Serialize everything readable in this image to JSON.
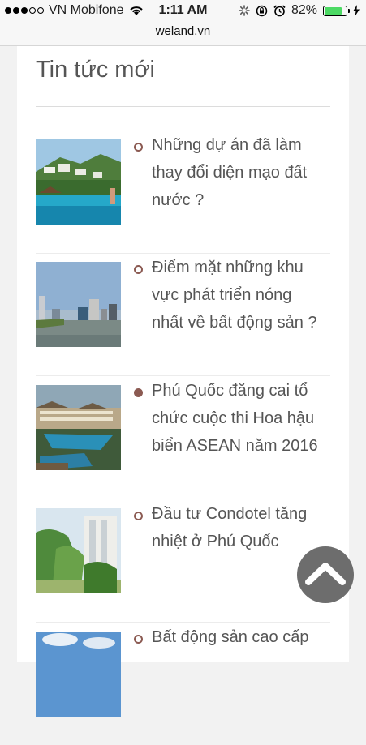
{
  "status": {
    "carrier": "VN Mobifone",
    "time": "1:11 AM",
    "battery_percent": "82%",
    "battery_level": 0.82,
    "signal_dots_full": 3,
    "signal_dots_total": 5
  },
  "browser": {
    "url": "weland.vn"
  },
  "section": {
    "title": "Tin tức mới"
  },
  "news": [
    {
      "title": "Những dự án đã làm thay đổi diện mạo đất nước ?",
      "bullet": "hollow",
      "image": "resort-pool"
    },
    {
      "title": "Điểm mặt những khu vực phát triển nóng nhất về bất động sản ?",
      "bullet": "hollow",
      "image": "city-skyline"
    },
    {
      "title": "Phú Quốc đăng cai tổ chức cuộc thi Hoa hậu biển ASEAN năm 2016",
      "bullet": "filled",
      "image": "hotel-pool"
    },
    {
      "title": "Đầu tư Condotel tăng nhiệt ở Phú Quốc",
      "bullet": "hollow",
      "image": "condotel"
    },
    {
      "title": "Bất động sản cao cấp",
      "bullet": "hollow",
      "image": "sky"
    }
  ],
  "colors": {
    "accent": "#8b5a52",
    "scroll_button": "#6d6d6d",
    "battery_green": "#4cd964"
  },
  "icons": {
    "scroll_top": "chevron-up-icon"
  }
}
